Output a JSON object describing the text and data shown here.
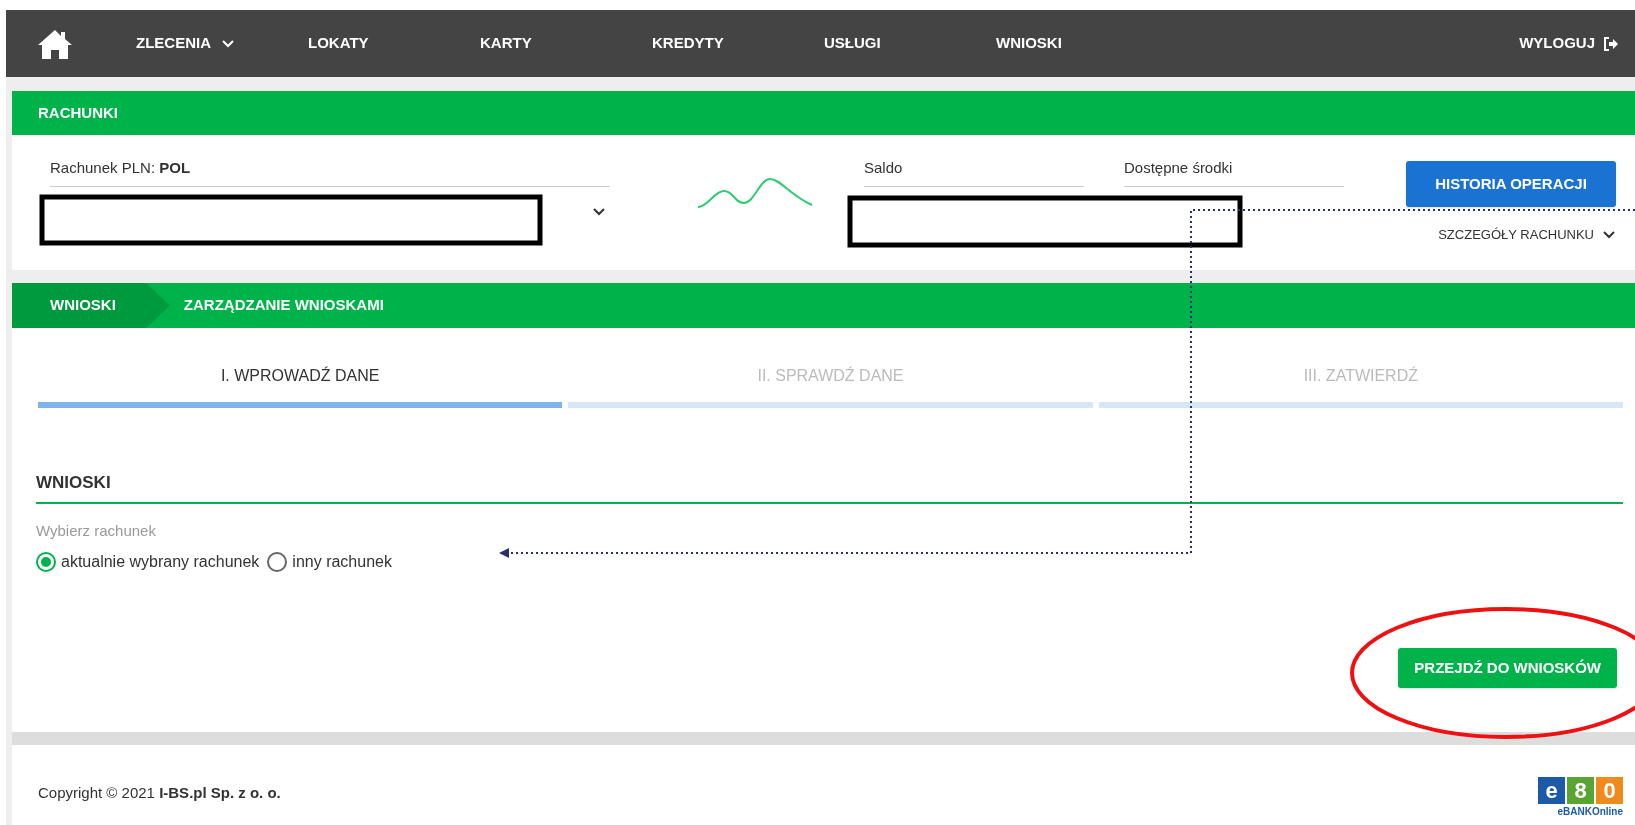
{
  "nav": {
    "items": [
      {
        "label": "ZLECENIA",
        "dropdown": true
      },
      {
        "label": "LOKATY",
        "dropdown": false
      },
      {
        "label": "KARTY",
        "dropdown": false
      },
      {
        "label": "KREDYTY",
        "dropdown": false
      },
      {
        "label": "USŁUGI",
        "dropdown": false
      },
      {
        "label": "WNIOSKI",
        "dropdown": false
      }
    ],
    "logout": "WYLOGUJ"
  },
  "accounts": {
    "title": "RACHUNKI",
    "account_label": "Rachunek PLN: **POL**",
    "balance_label": "Saldo",
    "available_label": "Dostępne środki",
    "history_button": "HISTORIA OPERACJI",
    "details_link": "SZCZEGÓŁY RACHUNKU"
  },
  "breadcrumb": [
    "WNIOSKI",
    "ZARZĄDZANIE WNIOSKAMI"
  ],
  "steps": [
    {
      "label": "I. WPROWADŹ DANE",
      "selected": true
    },
    {
      "label": "II. SPRAWDŹ DANE",
      "selected": false
    },
    {
      "label": "III. ZATWIERDŹ",
      "selected": false
    }
  ],
  "section": {
    "title": "WNIOSKI",
    "field_label": "Wybierz rachunek",
    "options": [
      {
        "label": "aktualnie wybrany rachunek",
        "selected": true
      },
      {
        "label": "inny rachunek",
        "selected": false
      }
    ],
    "submit": "PRZEJDŹ DO WNIOSKÓW"
  },
  "footer": {
    "copyright": "Copyright © 2021 **I-BS.pl Sp. z o. o.**",
    "logo": {
      "tiles": [
        {
          "char": "e",
          "color": "#1d5aa6"
        },
        {
          "char": "8",
          "color": "#5aa532"
        },
        {
          "char": "0",
          "color": "#f08a1c"
        }
      ],
      "caption": "eBANKOnline"
    }
  }
}
